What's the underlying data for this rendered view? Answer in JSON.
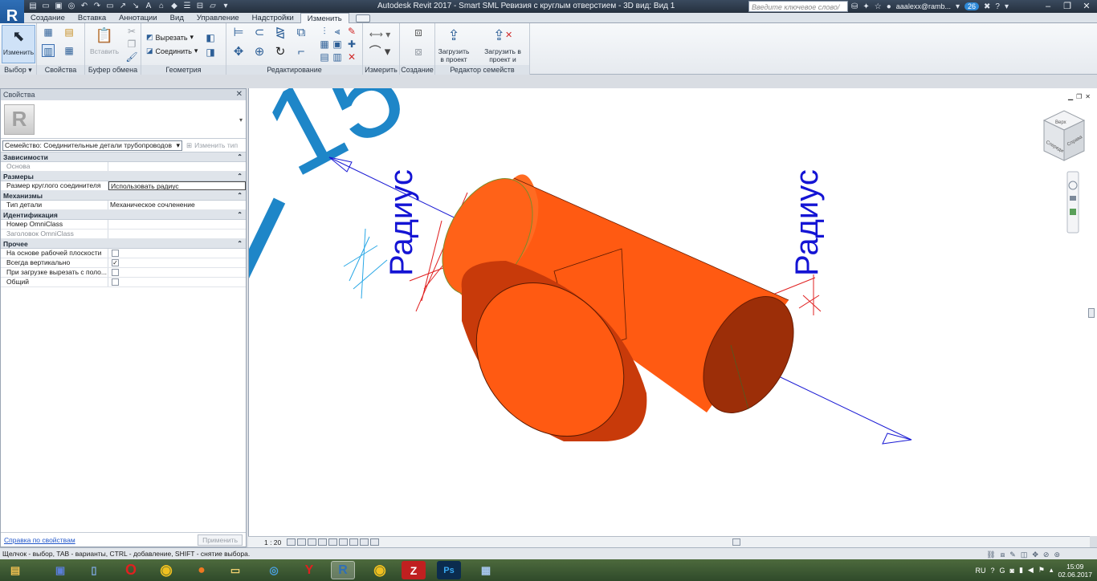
{
  "app": {
    "logo": "R",
    "title": "Autodesk Revit 2017 -     Smart SML Ревизия с круглым отверстием - 3D вид: Вид 1",
    "search_placeholder": "Введите ключевое слово/фразу",
    "user": "aaalexx@ramb...",
    "badge": "26"
  },
  "tabs": [
    "Создание",
    "Вставка",
    "Аннотации",
    "Вид",
    "Управление",
    "Надстройки",
    "Изменить"
  ],
  "ribbon": {
    "modify_label": "Изменить",
    "panels": {
      "select": "Выбор",
      "properties": "Свойства",
      "clipboard": "Буфер обмена",
      "geometry": "Геометрия",
      "modify": "Редактирование",
      "measure": "Измерить",
      "create": "Создание",
      "family_editor": "Редактор семейств"
    },
    "paste_label": "Вставить",
    "cut_label": "Вырезать",
    "join_label": "Соединить",
    "load_into_project": "Загрузить в проект",
    "load_into_project_close": "Загрузить в проект и закрыть"
  },
  "properties": {
    "title": "Свойства",
    "type_logo": "R",
    "family_select": "Семейство: Соединительные детали трубопроводов",
    "edit_type": "Изменить тип",
    "categories": [
      {
        "name": "Зависимости",
        "rows": [
          {
            "label": "Основа",
            "value": "",
            "grey": true
          }
        ]
      },
      {
        "name": "Размеры",
        "rows": [
          {
            "label": "Размер круглого соединителя",
            "value": "Использовать радиус",
            "edit": true
          }
        ]
      },
      {
        "name": "Механизмы",
        "rows": [
          {
            "label": "Тип детали",
            "value": "Механическое сочленение"
          }
        ]
      },
      {
        "name": "Идентификация",
        "rows": [
          {
            "label": "Номер OmniClass",
            "value": ""
          },
          {
            "label": "Заголовок OmniClass",
            "value": "",
            "grey": true
          }
        ]
      },
      {
        "name": "Прочее",
        "rows": [
          {
            "label": "На основе рабочей плоскости",
            "check": false
          },
          {
            "label": "Всегда вертикально",
            "check": true
          },
          {
            "label": "При загрузке вырезать с поло...",
            "check": false
          },
          {
            "label": "Общий",
            "check": false
          }
        ]
      }
    ],
    "help_link": "Справка по свойствам",
    "apply_button": "Применить"
  },
  "viewport": {
    "dimension_label_left": "Радиус",
    "dimension_label_right": "Радиус",
    "big_number": "15",
    "scale": "1 : 20",
    "viewcube_top": "Верх",
    "viewcube_front": "Спереди",
    "viewcube_right": "Справа"
  },
  "statusbar": {
    "text": "Щелчок - выбор, TAB - варианты, CTRL - добавление, SHIFT - снятие выбора."
  },
  "taskbar": {
    "lang": "RU",
    "time": "15:09",
    "date": "02.06.2017",
    "apps": [
      "explorer",
      "save",
      "doc",
      "opera",
      "chrome",
      "firefox",
      "folder",
      "outlook",
      "yandex",
      "revit",
      "chrome2",
      "filezilla",
      "photoshop",
      "remote"
    ]
  },
  "colors": {
    "pipe": "#ff5a12",
    "pipe_shadow": "#a0300a",
    "dimension_text": "#1414d4",
    "reference_red": "#e02020",
    "reference_cyan": "#2aa8e6",
    "arrow_blue": "#1a1ad4"
  }
}
